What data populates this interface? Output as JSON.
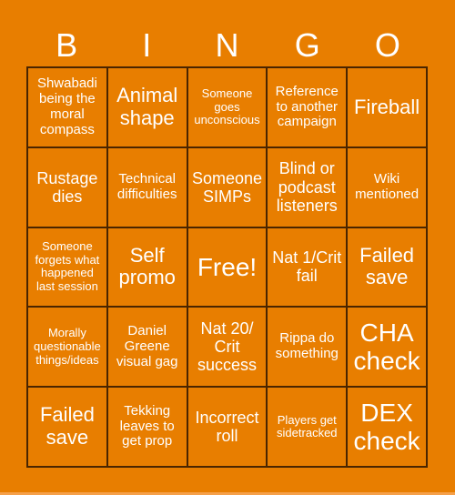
{
  "card": {
    "background_color": "#e87e00",
    "border_color": "#4a2500",
    "header": [
      "B",
      "I",
      "N",
      "G",
      "O"
    ],
    "cells": [
      [
        {
          "text": "Shwabadi being the moral compass",
          "size": "sm"
        },
        {
          "text": "Animal shape",
          "size": "lg"
        },
        {
          "text": "Someone goes unconscious",
          "size": "xs"
        },
        {
          "text": "Reference to another campaign",
          "size": "sm"
        },
        {
          "text": "Fireball",
          "size": "lg"
        }
      ],
      [
        {
          "text": "Rustage dies",
          "size": "md"
        },
        {
          "text": "Technical difficulties",
          "size": "sm"
        },
        {
          "text": "Someone SIMPs",
          "size": "md"
        },
        {
          "text": "Blind or podcast listeners",
          "size": "md"
        },
        {
          "text": "Wiki mentioned",
          "size": "sm"
        }
      ],
      [
        {
          "text": "Someone forgets what happened last session",
          "size": "xs"
        },
        {
          "text": "Self promo",
          "size": "lg"
        },
        {
          "text": "Free!",
          "size": "xl"
        },
        {
          "text": "Nat 1/Crit fail",
          "size": "md"
        },
        {
          "text": "Failed save",
          "size": "lg"
        }
      ],
      [
        {
          "text": "Morally questionable things/ideas",
          "size": "xs"
        },
        {
          "text": "Daniel Greene visual gag",
          "size": "sm"
        },
        {
          "text": "Nat 20/ Crit success",
          "size": "md"
        },
        {
          "text": "Rippa do something",
          "size": "sm"
        },
        {
          "text": "CHA check",
          "size": "xl"
        }
      ],
      [
        {
          "text": "Failed save",
          "size": "lg"
        },
        {
          "text": "Tekking leaves to get prop",
          "size": "sm"
        },
        {
          "text": "Incorrect roll",
          "size": "md"
        },
        {
          "text": "Players get sidetracked",
          "size": "xs"
        },
        {
          "text": "DEX check",
          "size": "xl"
        }
      ]
    ]
  }
}
